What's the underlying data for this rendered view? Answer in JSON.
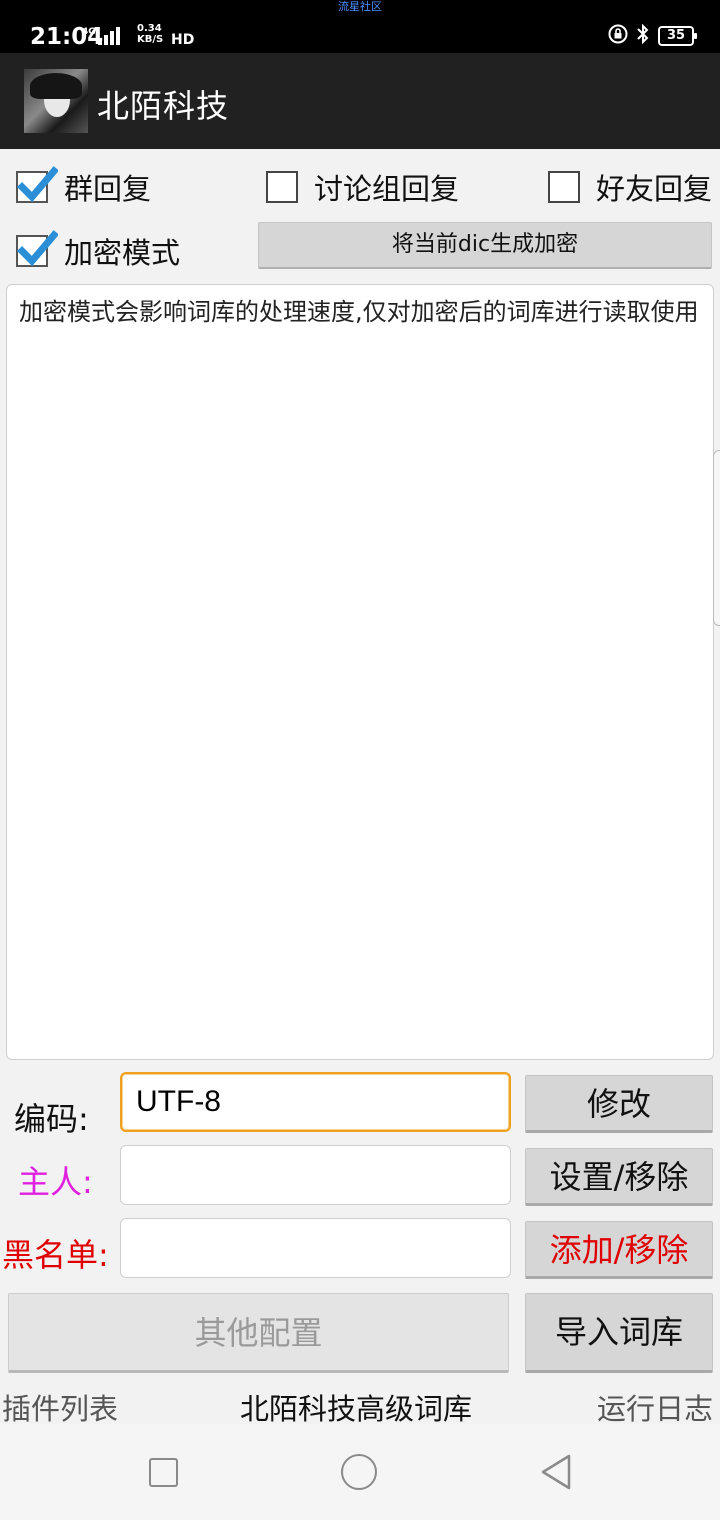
{
  "status_bar": {
    "notice": "流星社区",
    "time": "21:04",
    "network": "4G",
    "speed_value": "0.34",
    "speed_unit": "KB/S",
    "hd": "HD",
    "battery": "35"
  },
  "app_bar": {
    "title": "北陌科技"
  },
  "options": {
    "group_reply": {
      "label": "群回复",
      "checked": true
    },
    "discussion_reply": {
      "label": "讨论组回复",
      "checked": false
    },
    "friend_reply": {
      "label": "好友回复",
      "checked": false
    },
    "encrypt_mode": {
      "label": "加密模式",
      "checked": true
    }
  },
  "generate_button": "将当前dic生成加密",
  "message_text": "加密模式会影响词库的处理速度,仅对加密后的词库进行读取使用",
  "form": {
    "encoding": {
      "label": "编码:",
      "value": "UTF-8",
      "button": "修改"
    },
    "owner": {
      "label": "主人:",
      "value": "",
      "button": "设置/移除",
      "color": "#e020e0"
    },
    "blacklist": {
      "label": "黑名单:",
      "value": "",
      "button": "添加/移除",
      "color": "#e00000"
    }
  },
  "other_config_button": "其他配置",
  "import_button": "导入词库",
  "tabs": {
    "plugins": "插件列表",
    "advanced": "北陌科技高级词库",
    "log": "运行日志"
  },
  "colors": {
    "accent": "#2a8fd6",
    "app_bar": "#212121"
  }
}
